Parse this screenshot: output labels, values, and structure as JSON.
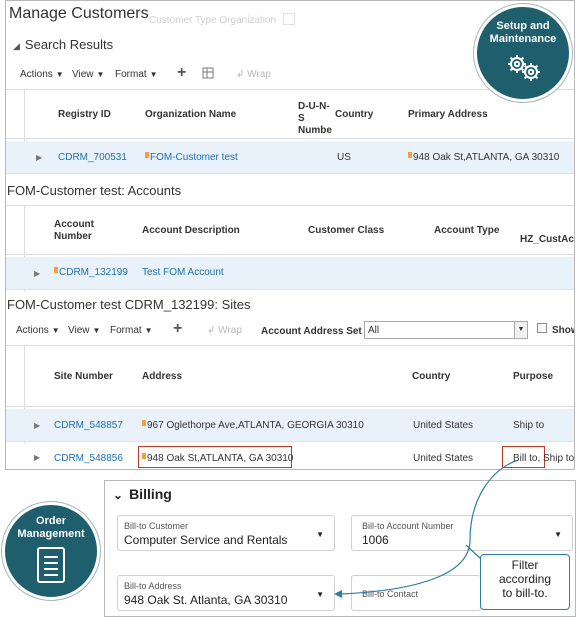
{
  "page": {
    "title": "Manage Customers",
    "ghost_search_label": "Customer Type   Organization"
  },
  "search_results": {
    "heading": "Search Results",
    "toolbar": {
      "actions": "Actions",
      "view": "View",
      "format": "Format",
      "wrap": "Wrap"
    },
    "columns": [
      "Registry ID",
      "Organization Name",
      "D-U-N-S Number",
      "Country",
      "Primary Address"
    ],
    "row": {
      "registry_id": "CDRM_700531",
      "organization_name": "FOM-Customer test",
      "country": "US",
      "primary_address": "948 Oak St,ATLANTA, GA 30310"
    }
  },
  "accounts": {
    "heading": "FOM-Customer test: Accounts",
    "columns": [
      "Account Number",
      "Account Description",
      "Customer Class",
      "Account Type",
      "HZ_CustAc"
    ],
    "row": {
      "account_number": "CDRM_132199",
      "account_description": "Test FOM Account"
    }
  },
  "sites": {
    "heading": "FOM-Customer test CDRM_132199: Sites",
    "toolbar": {
      "actions": "Actions",
      "view": "View",
      "format": "Format",
      "wrap": "Wrap",
      "account_address_set_label": "Account Address Set",
      "account_address_set_value": "All",
      "show_label": "Show"
    },
    "columns": [
      "Site Number",
      "Address",
      "Country",
      "Purpose"
    ],
    "rows": [
      {
        "site_number": "CDRM_548857",
        "address": "967 Oglethorpe Ave,ATLANTA, GEORGIA 30310",
        "country": "United States",
        "purpose": "Ship to"
      },
      {
        "site_number": "CDRM_548856",
        "address": "948 Oak St,ATLANTA, GA 30310",
        "country": "United States",
        "purpose": "Bill to, Ship to"
      }
    ]
  },
  "badges": {
    "setup": {
      "line1": "Setup and",
      "line2": "Maintenance",
      "icon": "gears-icon"
    },
    "order": {
      "line1": "Order",
      "line2": "Management",
      "icon": "document-icon"
    }
  },
  "billing": {
    "heading": "Billing",
    "bill_to_customer": {
      "label": "Bill-to Customer",
      "value": "Computer Service and Rentals"
    },
    "bill_to_account_number": {
      "label": "Bill-to Account Number",
      "value": "1006"
    },
    "bill_to_address": {
      "label": "Bill-to Address",
      "value": "948 Oak St. Atlanta, GA 30310"
    },
    "bill_to_contact": {
      "label": "Bill-to Contact"
    }
  },
  "callout": {
    "line1": "Filter",
    "line2": "according",
    "line3": "to bill-to."
  },
  "colors": {
    "accent_teal": "#1e5e6d",
    "link_blue": "#1f6fad",
    "highlight_red": "#c0392b",
    "row_selected": "#e9f2fa",
    "callout_border": "#2f7da0"
  }
}
